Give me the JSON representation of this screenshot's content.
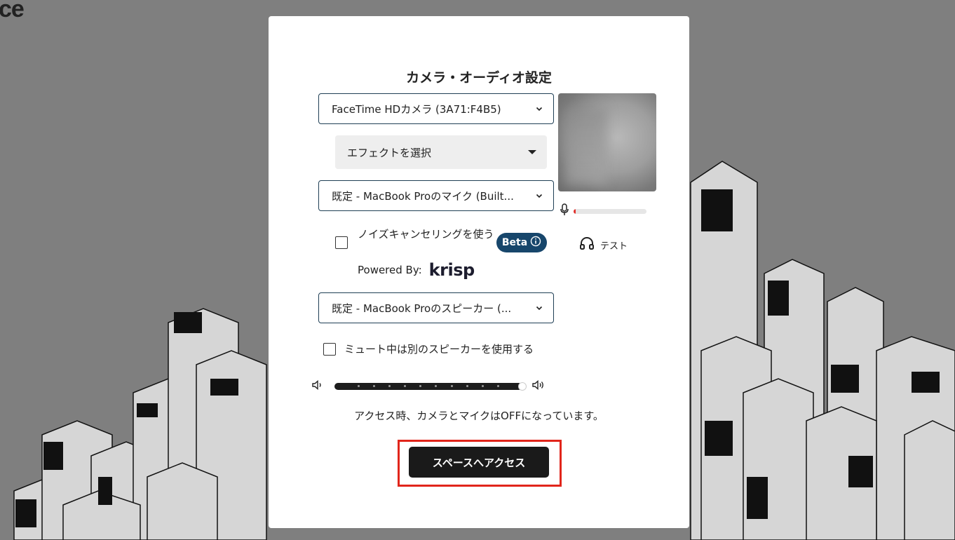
{
  "background": {
    "logo_fragment": "ce"
  },
  "modal": {
    "title": "カメラ・オーディオ設定",
    "camera_select": {
      "value": "FaceTime HDカメラ (3A71:F4B5)"
    },
    "effect_select": {
      "value": "エフェクトを選択"
    },
    "mic_select": {
      "value": "既定 - MacBook Proのマイク (Built..."
    },
    "mic_level_percent": 3,
    "noise_cancel": {
      "label": "ノイズキャンセリングを使う",
      "checked": false,
      "badge": "Beta",
      "powered_by": "Powered By:",
      "brand": "krisp"
    },
    "test_label": "テスト",
    "speaker_select": {
      "value": "既定 - MacBook Proのスピーカー (..."
    },
    "mute_option": {
      "label": "ミュート中は別のスピーカーを使用する",
      "checked": false
    },
    "volume_percent": 100,
    "notice": "アクセス時、カメラとマイクはOFFになっています。",
    "access_button": "スペースへアクセス"
  },
  "colors": {
    "accent": "#17466b",
    "highlight": "#e1251b",
    "button": "#1a1a1a",
    "mic_level": "#e2312d"
  }
}
